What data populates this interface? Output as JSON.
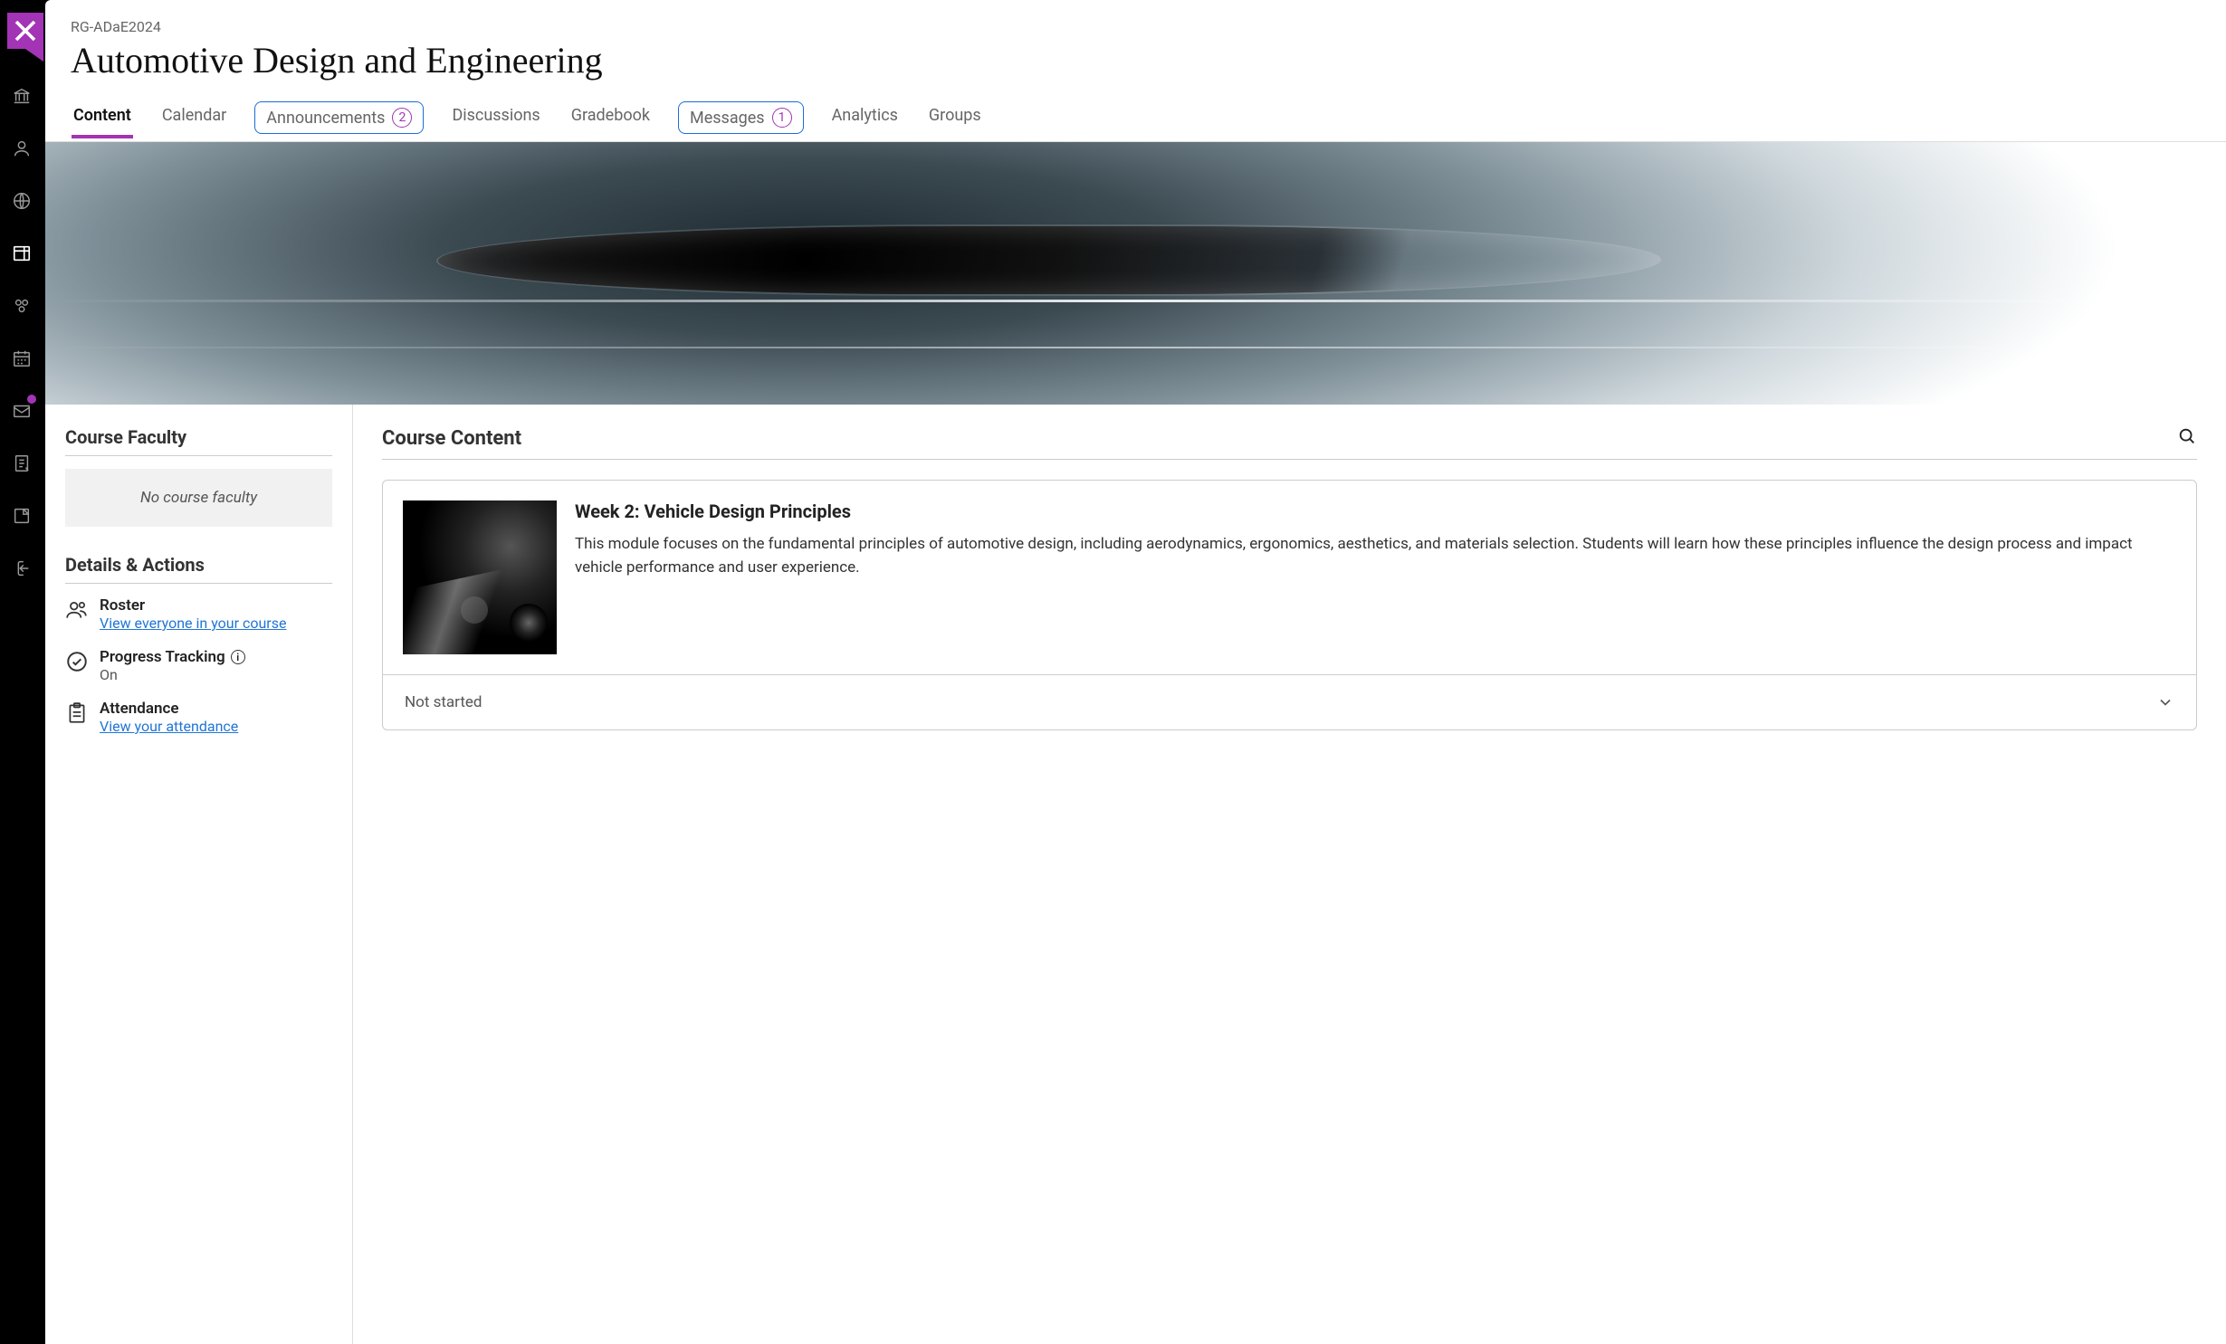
{
  "course_code": "RG-ADaE2024",
  "course_title": "Automotive Design and Engineering",
  "tabs": {
    "content": "Content",
    "calendar": "Calendar",
    "announcements": "Announcements",
    "announcements_badge": "2",
    "discussions": "Discussions",
    "gradebook": "Gradebook",
    "messages": "Messages",
    "messages_badge": "1",
    "analytics": "Analytics",
    "groups": "Groups"
  },
  "left": {
    "faculty_heading": "Course Faculty",
    "no_faculty": "No course faculty",
    "details_heading": "Details & Actions",
    "roster_title": "Roster",
    "roster_link": "View everyone in your course",
    "progress_title": "Progress Tracking",
    "progress_status": "On",
    "attendance_title": "Attendance",
    "attendance_link": "View your attendance"
  },
  "content": {
    "heading": "Course Content",
    "module_title": "Week 2: Vehicle Design Principles",
    "module_desc": "This module focuses on the fundamental principles of automotive design, including aerodynamics, ergonomics, aesthetics, and materials selection. Students will learn how these principles influence the design process and impact vehicle performance and user experience.",
    "status": "Not started"
  }
}
